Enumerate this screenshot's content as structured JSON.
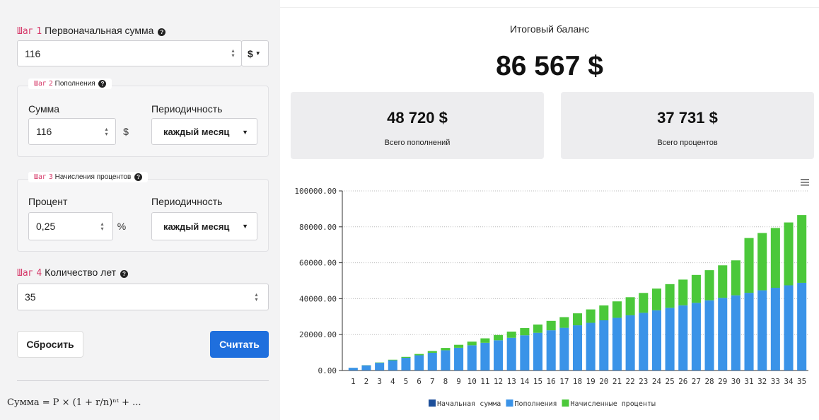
{
  "step1": {
    "word": "Шаг",
    "num": "1",
    "title": "Первоначальная сумма",
    "value": "116",
    "currency": "$"
  },
  "step2": {
    "word": "Шаг",
    "num": "2",
    "title": "Пополнения",
    "sum_label": "Сумма",
    "sum_value": "116",
    "sum_addon": "$",
    "period_label": "Периодичность",
    "period_value": "каждый месяц"
  },
  "step3": {
    "word": "Шаг",
    "num": "3",
    "title": "Начисления процентов",
    "rate_label": "Процент",
    "rate_value": "0,25",
    "rate_addon": "%",
    "period_label": "Периодичность",
    "period_value": "каждый месяц"
  },
  "step4": {
    "word": "Шаг",
    "num": "4",
    "title": "Количество лет",
    "value": "35"
  },
  "buttons": {
    "reset": "Сбросить",
    "calculate": "Считать"
  },
  "formula": "Сумма = P × (1 + r/n)ⁿᵗ + ...",
  "results": {
    "title": "Итоговый баланс",
    "total": "86 567 $",
    "deposits_value": "48 720 $",
    "deposits_label": "Всего пополнений",
    "interest_value": "37 731 $",
    "interest_label": "Всего процентов"
  },
  "colors": {
    "accent": "#1f6fdd",
    "initial": "#1d4f9a",
    "deposits": "#3a93e8",
    "interest": "#4bc83a",
    "step": "#d63a6a"
  },
  "chart_data": {
    "type": "bar",
    "stacked": true,
    "categories": [
      "1",
      "2",
      "3",
      "4",
      "5",
      "6",
      "7",
      "8",
      "9",
      "10",
      "11",
      "12",
      "13",
      "14",
      "15",
      "16",
      "17",
      "18",
      "19",
      "20",
      "21",
      "22",
      "23",
      "24",
      "25",
      "26",
      "27",
      "28",
      "29",
      "30",
      "31",
      "32",
      "33",
      "34",
      "35"
    ],
    "ylim": [
      0,
      100000
    ],
    "yticks": [
      "0.00",
      "20000.00",
      "40000.00",
      "60000.00",
      "80000.00",
      "100000.00"
    ],
    "grid": true,
    "legend_position": "bottom",
    "series": [
      {
        "name": "Начальная сумма",
        "color": "#1d4f9a",
        "values": [
          116,
          116,
          116,
          116,
          116,
          116,
          116,
          116,
          116,
          116,
          116,
          116,
          116,
          116,
          116,
          116,
          116,
          116,
          116,
          116,
          116,
          116,
          116,
          116,
          116,
          116,
          116,
          116,
          116,
          116,
          116,
          116,
          116,
          116,
          116
        ]
      },
      {
        "name": "Пополнения",
        "color": "#3a93e8",
        "values": [
          1392,
          2784,
          4176,
          5568,
          6960,
          8352,
          9744,
          11136,
          12528,
          13920,
          15312,
          16704,
          18096,
          19488,
          20880,
          22272,
          23664,
          25056,
          26448,
          27840,
          29232,
          30624,
          32016,
          33408,
          34800,
          36192,
          37584,
          38976,
          40368,
          41760,
          43152,
          44544,
          45936,
          47328,
          48720
        ]
      },
      {
        "name": "Начисленные проценты",
        "color": "#4bc83a",
        "values": [
          20,
          80,
          180,
          320,
          500,
          730,
          1000,
          1310,
          1660,
          2050,
          2480,
          2950,
          3460,
          4010,
          4610,
          5250,
          5940,
          6670,
          7450,
          8280,
          9150,
          10080,
          11060,
          12090,
          13180,
          14320,
          15520,
          16770,
          18080,
          19450,
          30500,
          31900,
          33300,
          35000,
          37731
        ]
      }
    ]
  }
}
